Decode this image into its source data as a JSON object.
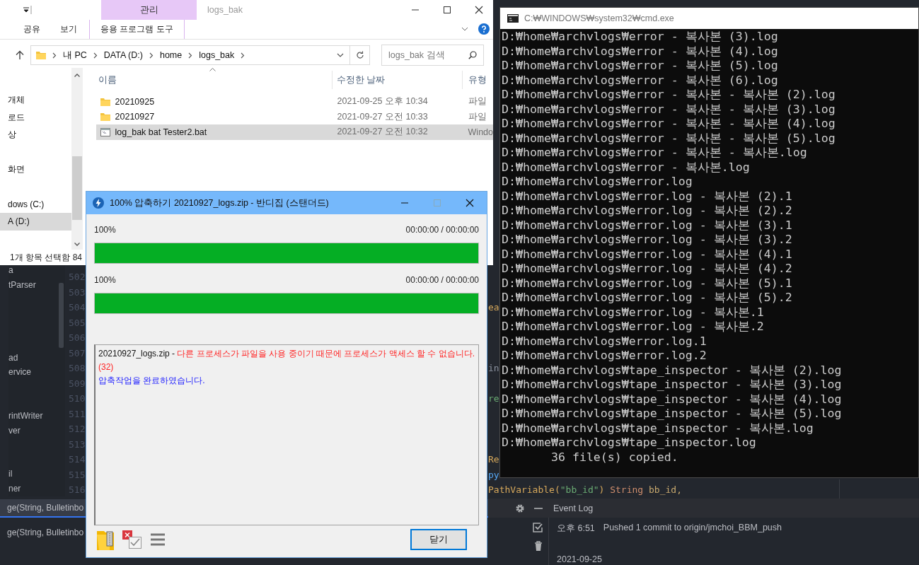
{
  "explorer": {
    "title": "logs_bak",
    "context_group": "관리",
    "ribbon_tabs": [
      "공유",
      "보기"
    ],
    "context_tab": "응용 프로그램 도구",
    "breadcrumbs": [
      "내 PC",
      "DATA (D:)",
      "home",
      "logs_bak"
    ],
    "search": {
      "placeholder": "logs_bak 검색"
    },
    "nav_items": [
      {
        "label": "개체",
        "selected": false
      },
      {
        "label": "로드",
        "selected": false
      },
      {
        "label": "상",
        "selected": false
      },
      {
        "label": "화면",
        "selected": false
      },
      {
        "label": "dows (C:)",
        "selected": false
      },
      {
        "label": "A (D:)",
        "selected": true
      }
    ],
    "columns": [
      "이름",
      "수정한 날짜",
      "유형"
    ],
    "files": [
      {
        "kind": "folder",
        "name": "20210925",
        "date": "2021-09-25 오후 10:34",
        "type": "파일",
        "selected": false
      },
      {
        "kind": "folder",
        "name": "20210927",
        "date": "2021-09-27 오전 10:33",
        "type": "파일",
        "selected": false
      },
      {
        "kind": "batch",
        "name": "log_bak bat Tester2.bat",
        "date": "2021-09-27 오전 10:32",
        "type": "Windo",
        "selected": true
      }
    ],
    "status": "1개 항목 선택함 84"
  },
  "bandizip": {
    "title": "100% 압축하기 20210927_logs.zip - 반디집 (스탠더드)",
    "progress": [
      {
        "label": "100%",
        "time": "00:00:00 / 00:00:00",
        "level": 1
      },
      {
        "label": "100%",
        "time": "00:00:00 / 00:00:00",
        "level": 1
      }
    ],
    "log": [
      {
        "kind": "error",
        "source": "20210927_logs.zip -",
        "message": "다른 프로세스가 파일을 사용 중이기 때문에 프로세스가 액세스 할 수 없습니다.(32)"
      },
      {
        "kind": "info",
        "message": "압축작업을 완료하였습니다."
      }
    ],
    "close_button": "닫기"
  },
  "cmd": {
    "title": "C:₩WINDOWS₩system32₩cmd.exe",
    "lines": [
      "D:₩home₩archvlogs₩error - 복사본 (3).log",
      "D:₩home₩archvlogs₩error - 복사본 (4).log",
      "D:₩home₩archvlogs₩error - 복사본 (5).log",
      "D:₩home₩archvlogs₩error - 복사본 (6).log",
      "D:₩home₩archvlogs₩error - 복사본 - 복사본 (2).log",
      "D:₩home₩archvlogs₩error - 복사본 - 복사본 (3).log",
      "D:₩home₩archvlogs₩error - 복사본 - 복사본 (4).log",
      "D:₩home₩archvlogs₩error - 복사본 - 복사본 (5).log",
      "D:₩home₩archvlogs₩error - 복사본 - 복사본.log",
      "D:₩home₩archvlogs₩error - 복사본.log",
      "D:₩home₩archvlogs₩error.log",
      "D:₩home₩archvlogs₩error.log - 복사본 (2).1",
      "D:₩home₩archvlogs₩error.log - 복사본 (2).2",
      "D:₩home₩archvlogs₩error.log - 복사본 (3).1",
      "D:₩home₩archvlogs₩error.log - 복사본 (3).2",
      "D:₩home₩archvlogs₩error.log - 복사본 (4).1",
      "D:₩home₩archvlogs₩error.log - 복사본 (4).2",
      "D:₩home₩archvlogs₩error.log - 복사본 (5).1",
      "D:₩home₩archvlogs₩error.log - 복사본 (5).2",
      "D:₩home₩archvlogs₩error.log - 복사본.1",
      "D:₩home₩archvlogs₩error.log - 복사본.2",
      "D:₩home₩archvlogs₩error.log.1",
      "D:₩home₩archvlogs₩error.log.2",
      "D:₩home₩archvlogs₩tape_inspector - 복사본 (2).log",
      "D:₩home₩archvlogs₩tape_inspector - 복사본 (3).log",
      "D:₩home₩archvlogs₩tape_inspector - 복사본 (4).log",
      "D:₩home₩archvlogs₩tape_inspector - 복사본 (5).log",
      "D:₩home₩archvlogs₩tape_inspector - 복사본.log",
      "D:₩home₩archvlogs₩tape_inspector.log",
      "       36 file(s) copied."
    ]
  },
  "ide": {
    "sidebar_items": [
      "a",
      "tParser",
      "ad",
      "ervice",
      "rintWriter",
      "ver",
      "il",
      "ner"
    ],
    "code_lines": [
      {
        "number": "502"
      },
      {
        "number": "503"
      },
      {
        "number": "504",
        "tokens": [
          {
            "kind": "annotation",
            "text": "ea"
          }
        ]
      },
      {
        "number": "505"
      },
      {
        "number": "506"
      },
      {
        "number": "507"
      },
      {
        "number": "508",
        "tokens": [
          {
            "kind": "plain",
            "text": "in"
          }
        ]
      },
      {
        "number": "509"
      },
      {
        "number": "510",
        "tokens": [
          {
            "kind": "string",
            "text": "re"
          }
        ]
      },
      {
        "number": "511"
      },
      {
        "number": "512"
      },
      {
        "number": "513"
      },
      {
        "number": "514",
        "tokens": [
          {
            "kind": "annotation",
            "text": "Re"
          }
        ]
      },
      {
        "number": "515",
        "tokens": [
          {
            "kind": "call",
            "text": "py"
          }
        ]
      },
      {
        "number": "516",
        "tokens": [
          {
            "kind": "annotation",
            "text": "PathVariable("
          },
          {
            "kind": "string",
            "text": "\"bb_id\""
          },
          {
            "kind": "annotation",
            "text": ")"
          },
          {
            "kind": "keyword",
            "text": " String"
          },
          {
            "kind": "param",
            "text": " bb_id,"
          }
        ]
      }
    ],
    "structure_rows": [
      {
        "text": "ge(String, Bulletinbo",
        "selected": true
      },
      {
        "text": "ge(String, Bulletinbo",
        "selected": false
      }
    ],
    "event_log": {
      "title": "Event Log",
      "entries": [
        {
          "time": "오후 6:51",
          "message": "Pushed 1 commit to origin/jmchoi_BBM_push"
        }
      ],
      "date": "2021-09-25"
    }
  }
}
